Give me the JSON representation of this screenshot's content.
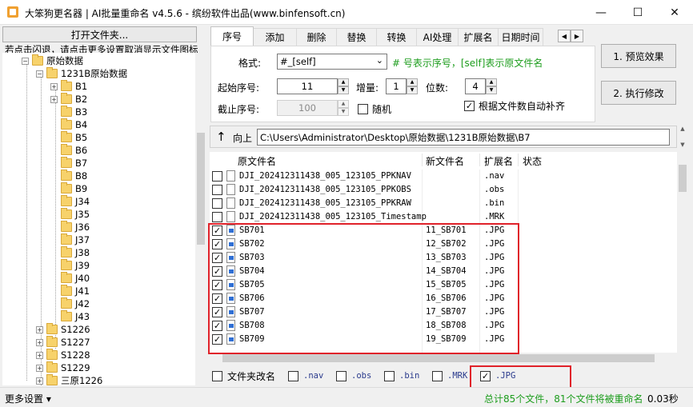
{
  "window": {
    "title": "大笨狗更名器 | AI批量重命名 v4.5.6 - 缤纷软件出品(www.binfensoft.cn)",
    "minimize_glyph": "—",
    "maximize_glyph": "☐",
    "close_glyph": "✕"
  },
  "left_panel": {
    "open_file_button": "打开文件夹...",
    "hint": "若点击闪退，请点击更多设置取消显示文件图标",
    "tree": [
      {
        "label": "原始数据",
        "level": 1,
        "toggle": "−"
      },
      {
        "label": "1231B原始数据",
        "level": 2,
        "toggle": "−"
      },
      {
        "label": "B1",
        "level": 3,
        "toggle": "+"
      },
      {
        "label": "B2",
        "level": 3,
        "toggle": "+"
      },
      {
        "label": "B3",
        "level": 3,
        "toggle": ""
      },
      {
        "label": "B4",
        "level": 3,
        "toggle": ""
      },
      {
        "label": "B5",
        "level": 3,
        "toggle": ""
      },
      {
        "label": "B6",
        "level": 3,
        "toggle": ""
      },
      {
        "label": "B7",
        "level": 3,
        "toggle": ""
      },
      {
        "label": "B8",
        "level": 3,
        "toggle": ""
      },
      {
        "label": "B9",
        "level": 3,
        "toggle": ""
      },
      {
        "label": "J34",
        "level": 3,
        "toggle": ""
      },
      {
        "label": "J35",
        "level": 3,
        "toggle": ""
      },
      {
        "label": "J36",
        "level": 3,
        "toggle": ""
      },
      {
        "label": "J37",
        "level": 3,
        "toggle": ""
      },
      {
        "label": "J38",
        "level": 3,
        "toggle": ""
      },
      {
        "label": "J39",
        "level": 3,
        "toggle": ""
      },
      {
        "label": "J40",
        "level": 3,
        "toggle": ""
      },
      {
        "label": "J41",
        "level": 3,
        "toggle": ""
      },
      {
        "label": "J42",
        "level": 3,
        "toggle": ""
      },
      {
        "label": "J43",
        "level": 3,
        "toggle": ""
      },
      {
        "label": "S1226",
        "level": 2,
        "toggle": "+"
      },
      {
        "label": "S1227",
        "level": 2,
        "toggle": "+"
      },
      {
        "label": "S1228",
        "level": 2,
        "toggle": "+"
      },
      {
        "label": "S1229",
        "level": 2,
        "toggle": "+"
      },
      {
        "label": "三原1226",
        "level": 2,
        "toggle": "+"
      }
    ]
  },
  "tabs": [
    {
      "label": "序号",
      "active": true
    },
    {
      "label": "添加",
      "active": false
    },
    {
      "label": "删除",
      "active": false
    },
    {
      "label": "替换",
      "active": false
    },
    {
      "label": "转换",
      "active": false
    },
    {
      "label": "AI处理",
      "active": false
    },
    {
      "label": "扩展名",
      "active": false
    },
    {
      "label": "日期时间",
      "active": false
    }
  ],
  "tab_arrows": {
    "left": "◀",
    "right": "▶"
  },
  "serial_tab": {
    "format_label": "格式:",
    "format_value": "#_[self]",
    "format_note": "# 号表示序号，[self]表示原文件名",
    "start_label": "起始序号:",
    "start_value": "11",
    "step_label": "增量:",
    "step_value": "1",
    "digits_label": "位数:",
    "digits_value": "4",
    "end_label": "截止序号:",
    "end_value": "100",
    "random_label": "随机",
    "random_checked": false,
    "auto_pad_label": "根据文件数自动补齐",
    "auto_pad_checked": true
  },
  "actions": {
    "preview_button": "1. 预览效果",
    "execute_button": "2. 执行修改"
  },
  "address": {
    "up_label": "向上",
    "up_glyph": "↑",
    "path": "C:\\Users\\Administrator\\Desktop\\原始数据\\1231B原始数据\\B7"
  },
  "file_list": {
    "columns": [
      "原文件名",
      "新文件名",
      "扩展名",
      "状态"
    ],
    "rows": [
      {
        "name": "DJI_202412311438_005_123105_PPKNAV",
        "new_name": "",
        "ext": ".nav",
        "checked": false,
        "icon": "file"
      },
      {
        "name": "DJI_202412311438_005_123105_PPKOBS",
        "new_name": "",
        "ext": ".obs",
        "checked": false,
        "icon": "file"
      },
      {
        "name": "DJI_202412311438_005_123105_PPKRAW",
        "new_name": "",
        "ext": ".bin",
        "checked": false,
        "icon": "file"
      },
      {
        "name": "DJI_202412311438_005_123105_Timestamp",
        "new_name": "",
        "ext": ".MRK",
        "checked": false,
        "icon": "file"
      },
      {
        "name": "SB701",
        "new_name": "11_SB701",
        "ext": ".JPG",
        "checked": true,
        "icon": "img"
      },
      {
        "name": "SB702",
        "new_name": "12_SB702",
        "ext": ".JPG",
        "checked": true,
        "icon": "img"
      },
      {
        "name": "SB703",
        "new_name": "13_SB703",
        "ext": ".JPG",
        "checked": true,
        "icon": "img"
      },
      {
        "name": "SB704",
        "new_name": "14_SB704",
        "ext": ".JPG",
        "checked": true,
        "icon": "img"
      },
      {
        "name": "SB705",
        "new_name": "15_SB705",
        "ext": ".JPG",
        "checked": true,
        "icon": "img"
      },
      {
        "name": "SB706",
        "new_name": "16_SB706",
        "ext": ".JPG",
        "checked": true,
        "icon": "img"
      },
      {
        "name": "SB707",
        "new_name": "17_SB707",
        "ext": ".JPG",
        "checked": true,
        "icon": "img"
      },
      {
        "name": "SB708",
        "new_name": "18_SB708",
        "ext": ".JPG",
        "checked": true,
        "icon": "img"
      },
      {
        "name": "SB709",
        "new_name": "19_SB709",
        "ext": ".JPG",
        "checked": true,
        "icon": "img"
      }
    ]
  },
  "filters": [
    {
      "label": "文件夹改名",
      "checked": false,
      "mono": false
    },
    {
      "label": ".nav",
      "checked": false,
      "mono": true
    },
    {
      "label": ".obs",
      "checked": false,
      "mono": true
    },
    {
      "label": ".bin",
      "checked": false,
      "mono": true
    },
    {
      "label": ".MRK",
      "checked": false,
      "mono": true
    },
    {
      "label": ".JPG",
      "checked": true,
      "mono": true
    }
  ],
  "status": {
    "more_settings": "更多设置 ▾",
    "summary": "总计85个文件，81个文件将被重命名",
    "elapsed": "0.03秒"
  },
  "colors": {
    "highlight_red": "#e0222a",
    "note_green": "#1d9d1d"
  }
}
